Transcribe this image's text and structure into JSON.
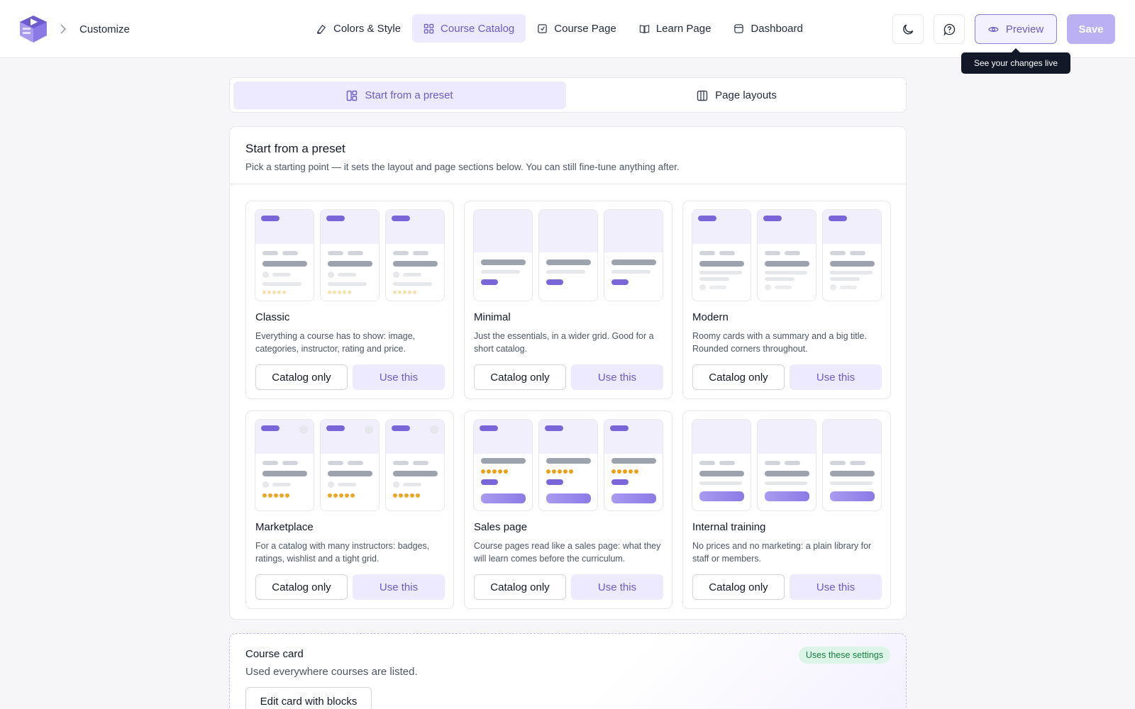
{
  "header": {
    "breadcrumb": "Customize",
    "nav": [
      {
        "label": "Colors & Style",
        "icon": "palette-icon"
      },
      {
        "label": "Course Catalog",
        "icon": "grid-icon",
        "active": true
      },
      {
        "label": "Course Page",
        "icon": "page-icon"
      },
      {
        "label": "Learn Page",
        "icon": "book-icon"
      },
      {
        "label": "Dashboard",
        "icon": "dashboard-icon"
      }
    ],
    "preview_label": "Preview",
    "save_label": "Save",
    "tooltip": "See your changes live"
  },
  "tabs": [
    {
      "label": "Start from a preset",
      "active": true
    },
    {
      "label": "Page layouts",
      "active": false
    }
  ],
  "preset_panel": {
    "title": "Start from a preset",
    "description": "Pick a starting point — it sets the layout and page sections below. You can still fine-tune anything after.",
    "presets": [
      {
        "name": "Classic",
        "description": "Everything a course has to show: image, categories, instructor, rating and price.",
        "catalog_label": "Catalog only",
        "use_label": "Use this"
      },
      {
        "name": "Minimal",
        "description": "Just the essentials, in a wider grid. Good for a short catalog.",
        "catalog_label": "Catalog only",
        "use_label": "Use this"
      },
      {
        "name": "Modern",
        "description": "Roomy cards with a summary and a big title. Rounded corners throughout.",
        "catalog_label": "Catalog only",
        "use_label": "Use this"
      },
      {
        "name": "Marketplace",
        "description": "For a catalog with many instructors: badges, ratings, wishlist and a tight grid.",
        "catalog_label": "Catalog only",
        "use_label": "Use this"
      },
      {
        "name": "Sales page",
        "description": "Course pages read like a sales page: what they will learn comes before the curriculum.",
        "catalog_label": "Catalog only",
        "use_label": "Use this"
      },
      {
        "name": "Internal training",
        "description": "No prices and no marketing: a plain library for staff or members.",
        "catalog_label": "Catalog only",
        "use_label": "Use this"
      }
    ]
  },
  "course_card": {
    "title": "Course card",
    "description": "Used everywhere courses are listed.",
    "badge": "Uses these settings",
    "edit_label": "Edit card with blocks"
  },
  "colors": {
    "accent": "#7a66d9",
    "accent_soft": "#ede9fe",
    "save_disabled": "#bbb1f2",
    "badge_green": "#15803d"
  }
}
